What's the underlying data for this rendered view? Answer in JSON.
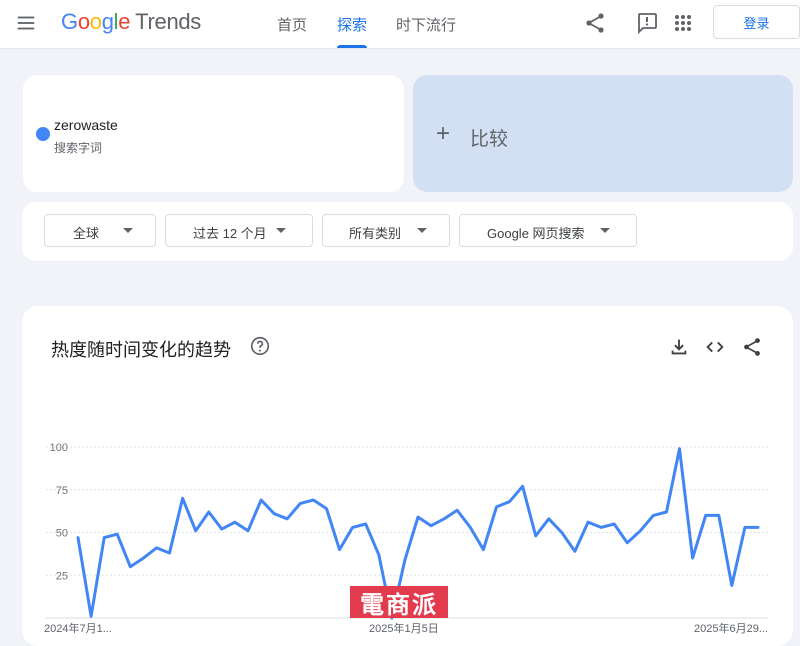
{
  "header": {
    "logo_google": "Google",
    "logo_trends": "Trends",
    "nav": [
      "首页",
      "探索",
      "时下流行"
    ],
    "active_nav": 1,
    "login_label": "登录"
  },
  "search": {
    "term": "zerowaste",
    "term_type": "搜索字词",
    "term_color": "#4285f4",
    "compare_label": "比较"
  },
  "filters": {
    "region": "全球",
    "time": "过去 12 个月",
    "category": "所有类别",
    "property": "Google 网页搜索"
  },
  "chart_section": {
    "title": "热度随时间变化的趋势",
    "icons": [
      "help-icon",
      "download-icon",
      "embed-icon",
      "share-icon"
    ]
  },
  "chart_data": {
    "type": "line",
    "ylim": [
      0,
      100
    ],
    "yticks": [
      25,
      50,
      75,
      100
    ],
    "x_labels": [
      "2024年7月1...",
      "2025年1月5日",
      "2025年6月29..."
    ],
    "series": [
      {
        "name": "zerowaste",
        "color": "#4285f4",
        "values": [
          47,
          1,
          47,
          49,
          30,
          35,
          41,
          38,
          70,
          51,
          62,
          52,
          56,
          51,
          69,
          61,
          58,
          67,
          69,
          64,
          40,
          53,
          55,
          37,
          0,
          34,
          59,
          54,
          58,
          63,
          53,
          40,
          65,
          68,
          77,
          48,
          58,
          50,
          39,
          56,
          53,
          55,
          44,
          51,
          60,
          62,
          99,
          35,
          60,
          60,
          19,
          53,
          53
        ]
      }
    ]
  },
  "watermark": "電商派"
}
